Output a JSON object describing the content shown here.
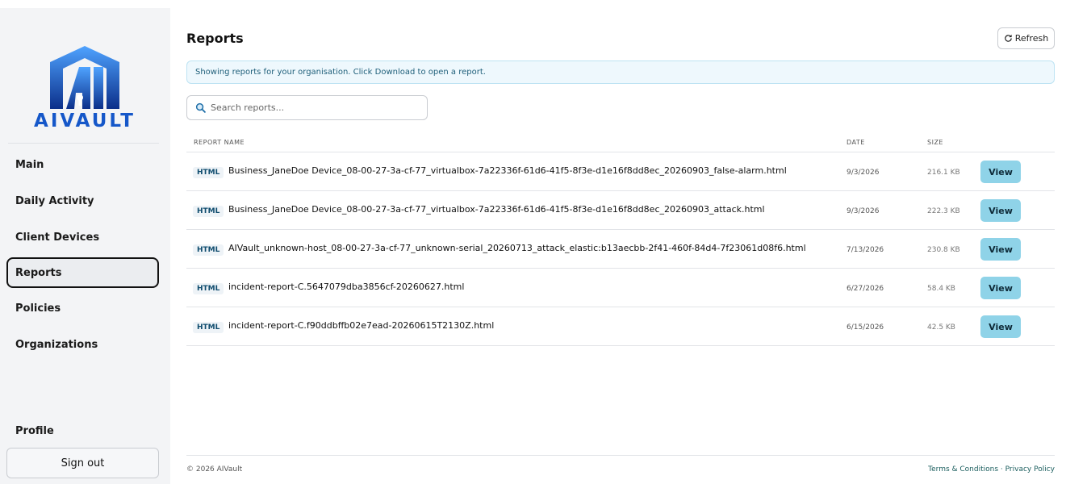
{
  "brand": {
    "name": "AIVAULT",
    "monogram": "AI",
    "colors": {
      "blue": "#1d6fe0",
      "dark_blue": "#0b2f8a",
      "light_blue": "#4fa3ff"
    }
  },
  "sidebar": {
    "items": [
      {
        "label": "Main",
        "active": false
      },
      {
        "label": "Daily Activity",
        "active": false
      },
      {
        "label": "Client Devices",
        "active": false
      },
      {
        "label": "Reports",
        "active": true
      },
      {
        "label": "Policies",
        "active": false
      },
      {
        "label": "Organizations",
        "active": false
      }
    ],
    "profile_label": "Profile",
    "signout_label": "Sign out"
  },
  "header": {
    "title": "Reports",
    "refresh_label": "Refresh",
    "refresh_icon": "refresh-icon"
  },
  "banner": {
    "text": "Showing reports for your organisation. Click Download to open a report."
  },
  "search": {
    "placeholder": "Search reports...",
    "value": "",
    "icon": "search-icon"
  },
  "table": {
    "columns": {
      "name": "REPORT NAME",
      "date": "DATE",
      "size": "SIZE"
    },
    "rows": [
      {
        "type": "HTML",
        "name": "Business_JaneDoe Device_08-00-27-3a-cf-77_virtualbox-7a22336f-61d6-41f5-8f3e-d1e16f8dd8ec_20260903_false-alarm.html",
        "date": "9/3/2026",
        "size": "216.1 KB",
        "action": "View"
      },
      {
        "type": "HTML",
        "name": "Business_JaneDoe Device_08-00-27-3a-cf-77_virtualbox-7a22336f-61d6-41f5-8f3e-d1e16f8dd8ec_20260903_attack.html",
        "date": "9/3/2026",
        "size": "222.3 KB",
        "action": "View"
      },
      {
        "type": "HTML",
        "name": "AIVault_unknown-host_08-00-27-3a-cf-77_unknown-serial_20260713_attack_elastic:b13aecbb-2f41-460f-84d4-7f23061d08f6.html",
        "date": "7/13/2026",
        "size": "230.8 KB",
        "action": "View"
      },
      {
        "type": "HTML",
        "name": "incident-report-C.5647079dba3856cf-20260627.html",
        "date": "6/27/2026",
        "size": "58.4 KB",
        "action": "View"
      },
      {
        "type": "HTML",
        "name": "incident-report-C.f90ddbffb02e7ead-20260615T2130Z.html",
        "date": "6/15/2026",
        "size": "42.5 KB",
        "action": "View"
      }
    ]
  },
  "footer": {
    "copyright": "© 2026 AIVault",
    "terms_label": "Terms & Conditions",
    "separator": "·",
    "privacy_label": "Privacy Policy"
  }
}
